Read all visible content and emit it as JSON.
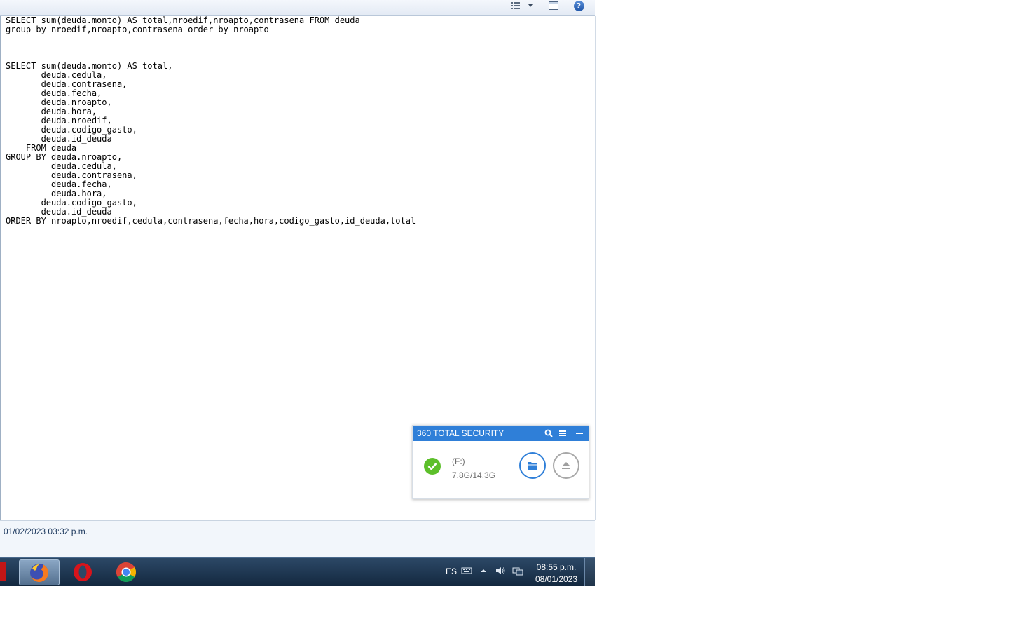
{
  "toolbar": {
    "views_icon": "views-icon",
    "preview_pane_icon": "preview-pane-icon",
    "help_icon": "help-icon",
    "help_glyph": "?"
  },
  "document": {
    "sql": "SELECT sum(deuda.monto) AS total,nroedif,nroapto,contrasena FROM deuda\ngroup by nroedif,nroapto,contrasena order by nroapto\n\n\n\nSELECT sum(deuda.monto) AS total,\n       deuda.cedula,\n       deuda.contrasena,\n       deuda.fecha,\n       deuda.nroapto,\n       deuda.hora,\n       deuda.nroedif,\n       deuda.codigo_gasto,\n       deuda.id_deuda\n    FROM deuda\nGROUP BY deuda.nroapto,\n         deuda.cedula,\n         deuda.contrasena,\n         deuda.fecha,\n         deuda.hora,\n       deuda.codigo_gasto,\n       deuda.id_deuda\nORDER BY nroapto,nroedif,cedula,contrasena,fecha,hora,codigo_gasto,id_deuda,total"
  },
  "details": {
    "modified": "01/02/2023 03:32 p.m."
  },
  "security_popup": {
    "title": "360 TOTAL SECURITY",
    "drive": "(F:)",
    "usage": "7.8G/14.3G",
    "accent": "#2f7fd8",
    "ok_color": "#5cbf2a"
  },
  "taskbar": {
    "apps": [
      "firefox-icon",
      "opera-icon",
      "chrome-icon"
    ],
    "language": "ES",
    "time": "08:55 p.m.",
    "date": "08/01/2023"
  }
}
